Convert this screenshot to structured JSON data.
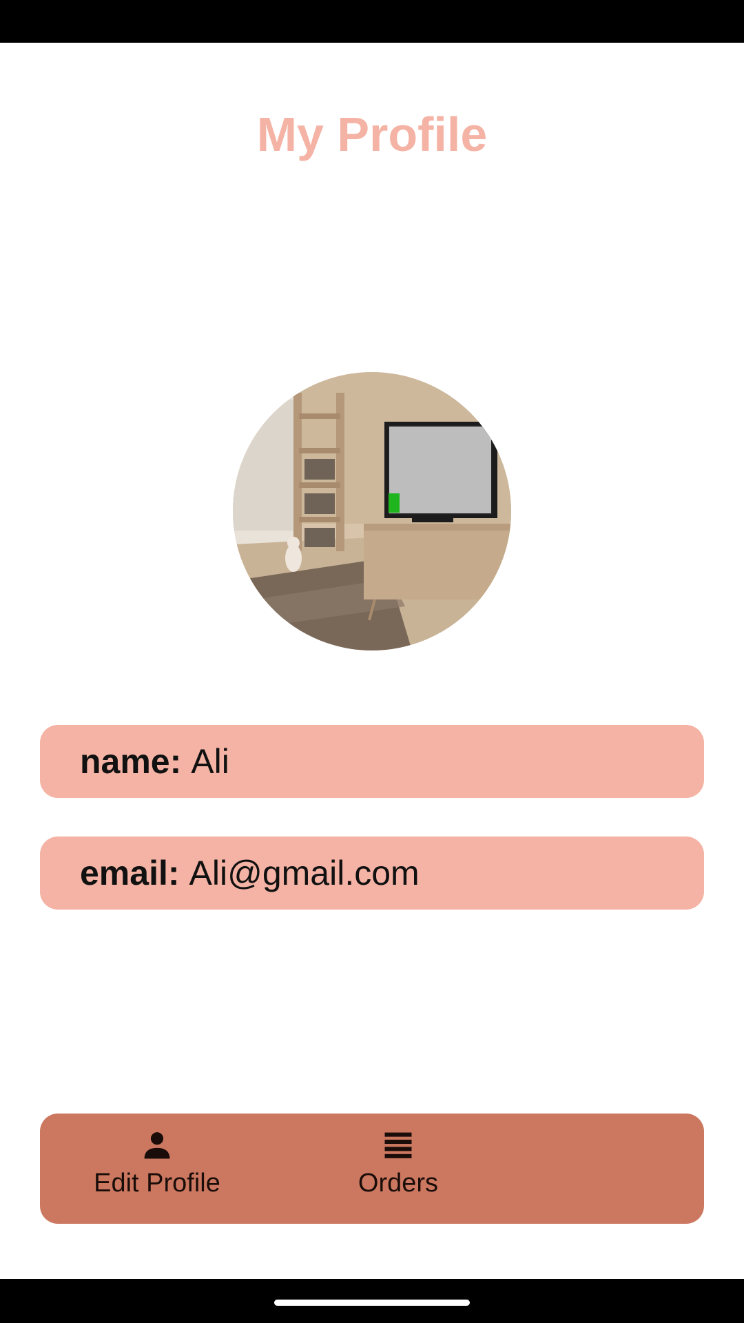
{
  "header": {
    "title": "My Profile"
  },
  "profile": {
    "avatar_alt": "profile photo",
    "name_label": "name:",
    "name_value": "Ali",
    "email_label": "email:",
    "email_value": "Ali@gmail.com"
  },
  "bottom_nav": {
    "items": [
      {
        "label": "Edit Profile",
        "icon": "person-icon"
      },
      {
        "label": "Orders",
        "icon": "list-icon"
      }
    ]
  },
  "colors": {
    "accent_light": "#f4b3a4",
    "accent_dark": "#cc7861",
    "text_dark": "#111111"
  }
}
